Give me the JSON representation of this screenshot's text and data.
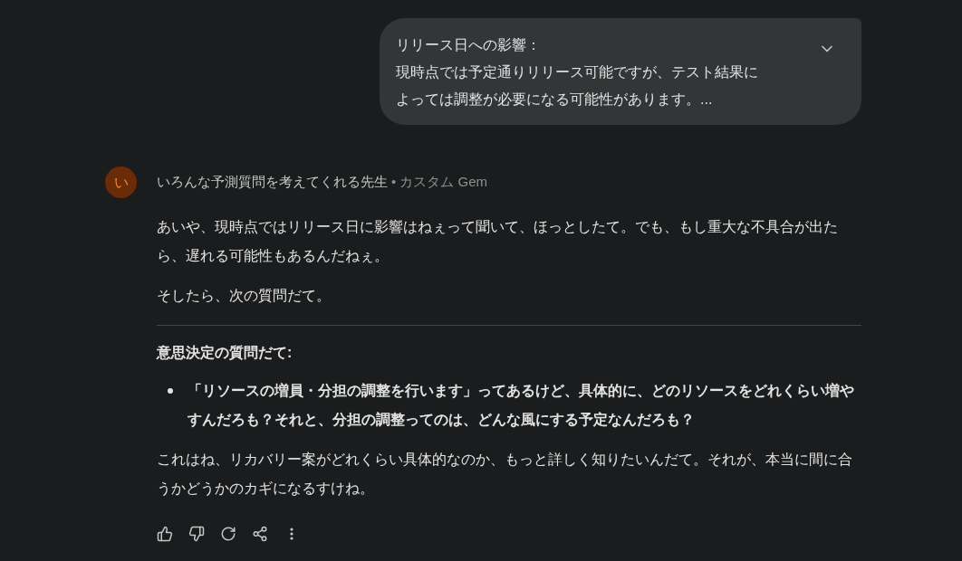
{
  "user_message": {
    "lines": [
      "リリース日への影響：",
      "現時点では予定通りリリース可能ですが、テスト結果に",
      "よっては調整が必要になる可能性があります。..."
    ]
  },
  "response": {
    "avatar_letter": "い",
    "author": "いろんな予測質問を考えてくれる先生",
    "author_suffix": "• カスタム Gem",
    "blocks": [
      {
        "kind": "paragraph",
        "text": "あいや、現時点ではリリース日に影響はねぇって聞いて、ほっとしたて。でも、もし重大な不具合が出たら、遅れる可能性もあるんだねぇ。"
      },
      {
        "kind": "paragraph",
        "text": "そしたら、次の質問だて。"
      },
      {
        "kind": "divider"
      },
      {
        "kind": "heading",
        "text": "意思決定の質問だて:"
      },
      {
        "kind": "bullets",
        "items": [
          "「リソースの増員・分担の調整を行います」ってあるけど、具体的に、どのリソースをどれくらい増やすんだろも？それと、分担の調整ってのは、どんな風にする予定なんだろも？"
        ]
      },
      {
        "kind": "paragraph",
        "text": "これはね、リカバリー案がどれくらい具体的なのか、もっと詳しく知りたいんだて。それが、本当に間に合うかどうかのカギになるすけね。"
      }
    ]
  }
}
